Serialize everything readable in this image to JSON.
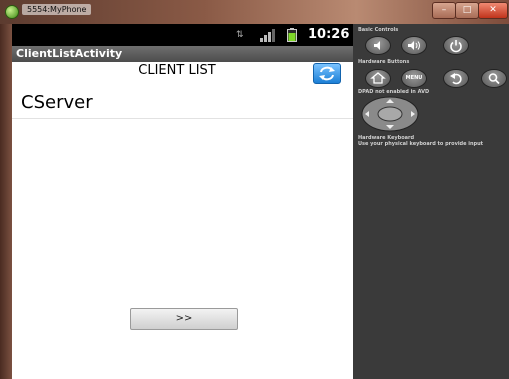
{
  "window": {
    "title": "5554:MyPhone"
  },
  "statusbar": {
    "time": "10:26"
  },
  "app": {
    "activity_title": "ClientListActivity",
    "list_title": "CLIENT LIST",
    "clients": [
      {
        "name": "CServer"
      }
    ],
    "next_button": ">>"
  },
  "panel": {
    "basic_controls_label": "Basic Controls",
    "hardware_buttons_label": "Hardware Buttons",
    "menu_button": "MENU",
    "dpad_label": "DPAD not enabled in AVD",
    "keyboard_label": "Hardware Keyboard",
    "keyboard_hint": "Use your physical keyboard to provide input"
  },
  "colors": {
    "status_bar": "#000000",
    "action_bar": "#5a5a5a",
    "refresh_blue": "#1c7fd6",
    "panel": "#3a3a3a",
    "close_button": "#c0331b"
  },
  "icons": [
    "app-icon",
    "signal-icon",
    "battery-icon",
    "refresh-icon",
    "volume-down-icon",
    "volume-up-icon",
    "power-icon",
    "home-icon",
    "back-icon",
    "search-icon",
    "dpad-icon"
  ]
}
